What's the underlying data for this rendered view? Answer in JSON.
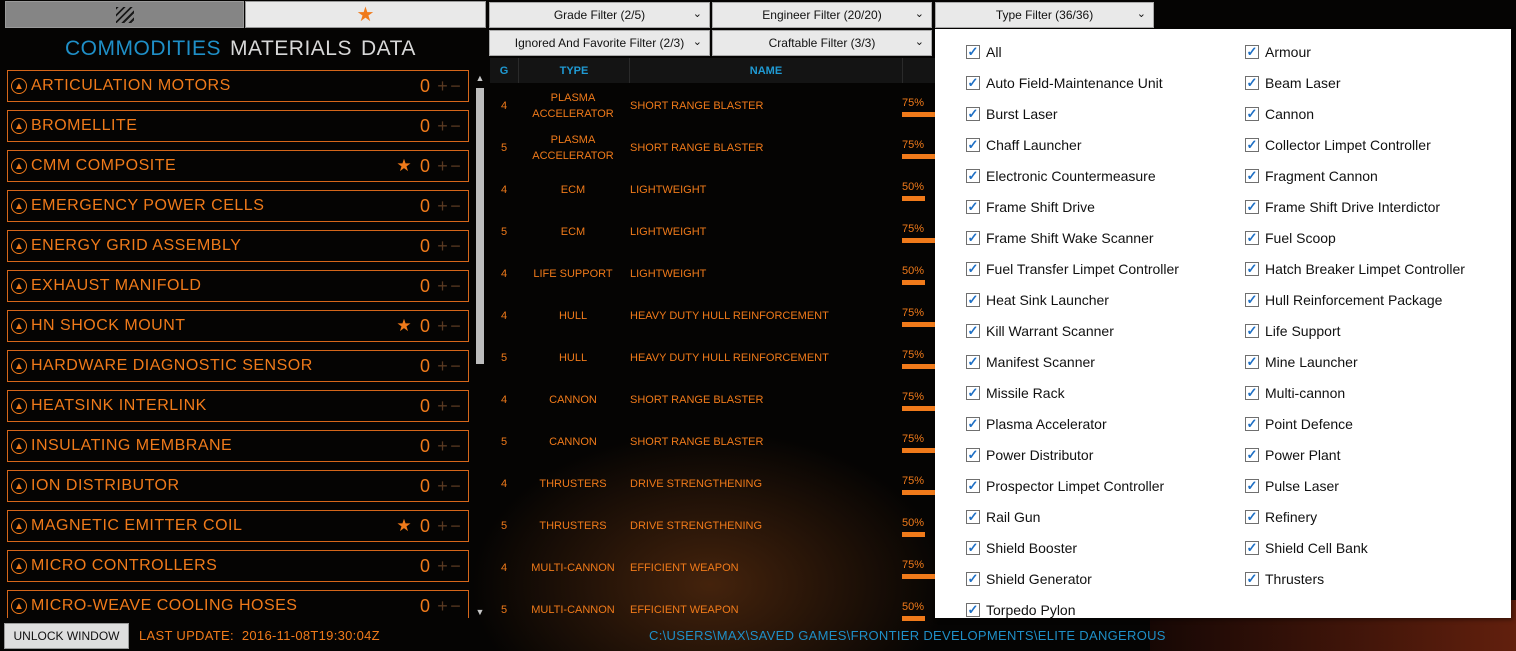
{
  "toggles": {
    "hatch_icon": "hatch-icon",
    "fav_icon": "★"
  },
  "categories": [
    {
      "label": "COMMODITIES",
      "active": true
    },
    {
      "label": "MATERIALS",
      "active": false
    },
    {
      "label": "DATA",
      "active": false
    }
  ],
  "commodities": [
    {
      "name": "ARTICULATION MOTORS",
      "count": "0",
      "favorite": false
    },
    {
      "name": "BROMELLITE",
      "count": "0",
      "favorite": false
    },
    {
      "name": "CMM COMPOSITE",
      "count": "0",
      "favorite": true
    },
    {
      "name": "EMERGENCY POWER CELLS",
      "count": "0",
      "favorite": false
    },
    {
      "name": "ENERGY GRID ASSEMBLY",
      "count": "0",
      "favorite": false
    },
    {
      "name": "EXHAUST MANIFOLD",
      "count": "0",
      "favorite": false
    },
    {
      "name": "HN SHOCK MOUNT",
      "count": "0",
      "favorite": true
    },
    {
      "name": "HARDWARE DIAGNOSTIC SENSOR",
      "count": "0",
      "favorite": false
    },
    {
      "name": "HEATSINK INTERLINK",
      "count": "0",
      "favorite": false
    },
    {
      "name": "INSULATING MEMBRANE",
      "count": "0",
      "favorite": false
    },
    {
      "name": "ION DISTRIBUTOR",
      "count": "0",
      "favorite": false
    },
    {
      "name": "MAGNETIC EMITTER COIL",
      "count": "0",
      "favorite": true
    },
    {
      "name": "MICRO CONTROLLERS",
      "count": "0",
      "favorite": false
    },
    {
      "name": "MICRO-WEAVE COOLING HOSES",
      "count": "0",
      "favorite": false
    }
  ],
  "commodity_symbols": {
    "plus": "+",
    "minus": "−",
    "star": "★"
  },
  "filters": {
    "grade": "Grade Filter (2/5)",
    "engineer": "Engineer Filter (20/20)",
    "type": "Type Filter (36/36)",
    "ignored": "Ignored And Favorite Filter (2/3)",
    "craftable": "Craftable Filter (3/3)",
    "chevron": "⌄"
  },
  "table": {
    "headers": {
      "g": "G",
      "type": "TYPE",
      "name": "NAME"
    },
    "rows": [
      {
        "g": "4",
        "type": "PLASMA ACCELERATOR",
        "name": "SHORT RANGE BLASTER",
        "progress": "75%",
        "fill": 0.75
      },
      {
        "g": "5",
        "type": "PLASMA ACCELERATOR",
        "name": "SHORT RANGE BLASTER",
        "progress": "75%",
        "fill": 0.75
      },
      {
        "g": "4",
        "type": "ECM",
        "name": "LIGHTWEIGHT",
        "progress": "50%",
        "fill": 0.5
      },
      {
        "g": "5",
        "type": "ECM",
        "name": "LIGHTWEIGHT",
        "progress": "75%",
        "fill": 0.75
      },
      {
        "g": "4",
        "type": "LIFE SUPPORT",
        "name": "LIGHTWEIGHT",
        "progress": "50%",
        "fill": 0.5
      },
      {
        "g": "4",
        "type": "HULL",
        "name": "HEAVY DUTY HULL REINFORCEMENT",
        "progress": "75%",
        "fill": 0.75
      },
      {
        "g": "5",
        "type": "HULL",
        "name": "HEAVY DUTY HULL REINFORCEMENT",
        "progress": "75%",
        "fill": 0.75
      },
      {
        "g": "4",
        "type": "CANNON",
        "name": "SHORT RANGE BLASTER",
        "progress": "75%",
        "fill": 0.75
      },
      {
        "g": "5",
        "type": "CANNON",
        "name": "SHORT RANGE BLASTER",
        "progress": "75%",
        "fill": 0.75
      },
      {
        "g": "4",
        "type": "THRUSTERS",
        "name": "DRIVE STRENGTHENING",
        "progress": "75%",
        "fill": 0.75
      },
      {
        "g": "5",
        "type": "THRUSTERS",
        "name": "DRIVE STRENGTHENING",
        "progress": "50%",
        "fill": 0.5
      },
      {
        "g": "4",
        "type": "MULTI-CANNON",
        "name": "EFFICIENT WEAPON",
        "progress": "75%",
        "fill": 0.75
      },
      {
        "g": "5",
        "type": "MULTI-CANNON",
        "name": "EFFICIENT WEAPON",
        "progress": "50%",
        "fill": 0.5
      }
    ]
  },
  "type_options": {
    "col1": [
      "All",
      "Auto Field-Maintenance Unit",
      "Burst Laser",
      "Chaff Launcher",
      "Electronic Countermeasure",
      "Frame Shift Drive",
      "Frame Shift Wake Scanner",
      "Fuel Transfer Limpet Controller",
      "Heat Sink Launcher",
      "Kill Warrant Scanner",
      "Manifest Scanner",
      "Missile Rack",
      "Plasma Accelerator",
      "Power Distributor",
      "Prospector Limpet Controller",
      "Rail Gun",
      "Shield Booster",
      "Shield Generator",
      "Torpedo Pylon"
    ],
    "col2": [
      "Armour",
      "Beam Laser",
      "Cannon",
      "Collector Limpet Controller",
      "Fragment Cannon",
      "Frame Shift Drive Interdictor",
      "Fuel Scoop",
      "Hatch Breaker Limpet Controller",
      "Hull Reinforcement Package",
      "Life Support",
      "Mine Launcher",
      "Multi-cannon",
      "Point Defence",
      "Power Plant",
      "Pulse Laser",
      "Refinery",
      "Shield Cell Bank",
      "Thrusters"
    ],
    "checkmark": "✓"
  },
  "status": {
    "unlock_label": "UNLOCK WINDOW",
    "last_update_label": "LAST UPDATE:",
    "last_update_value": "2016-11-08T19:30:04Z",
    "path": "C:\\USERS\\MAX\\SAVED GAMES\\FRONTIER DEVELOPMENTS\\ELITE DANGEROUS"
  },
  "colors": {
    "accent": "#f07a1a",
    "blue": "#1f8fc7",
    "bg": "#050403"
  }
}
